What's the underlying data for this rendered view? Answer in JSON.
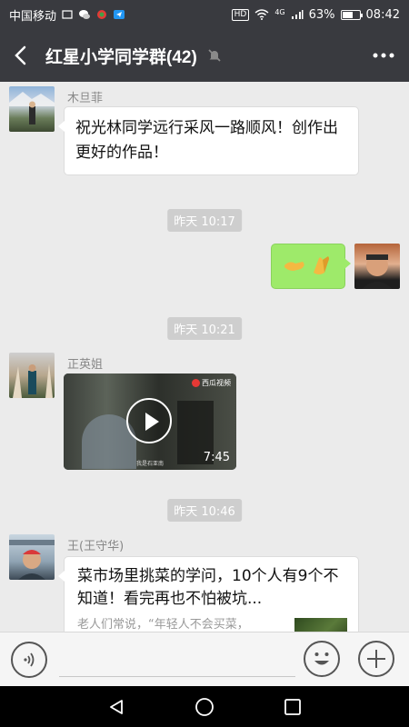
{
  "status_bar": {
    "carrier": "中国移动",
    "network": "4G",
    "battery_percent": "63%",
    "battery_level": 0.63,
    "time": "08:42",
    "hd_badge": "HD"
  },
  "header": {
    "title": "红星小学同学群(42)",
    "muted": true
  },
  "messages": [
    {
      "type": "text",
      "sender": "木旦菲",
      "text": "祝光林同学远行采风一路顺风！创作出更好的作品！"
    },
    {
      "type": "timestamp",
      "text": "昨天 10:17"
    },
    {
      "type": "emoji",
      "side": "right",
      "text": "🤝🙏"
    },
    {
      "type": "timestamp",
      "text": "昨天 10:21"
    },
    {
      "type": "video",
      "sender": "正英姐",
      "duration": "7:45",
      "source_logo": "西瓜视频",
      "caption": "我是石亚南"
    },
    {
      "type": "timestamp",
      "text": "昨天 10:46"
    },
    {
      "type": "article",
      "sender": "王(王守华)",
      "title": "菜市场里挑菜的学问，10个人有9个不知道！看完再也不怕被坑...",
      "desc": "老人们常说，“年轻人不会买菜，"
    }
  ],
  "colors": {
    "header_bg": "#393a3f",
    "chat_bg": "#ebebeb",
    "bubble_green": "#9eea6a"
  }
}
